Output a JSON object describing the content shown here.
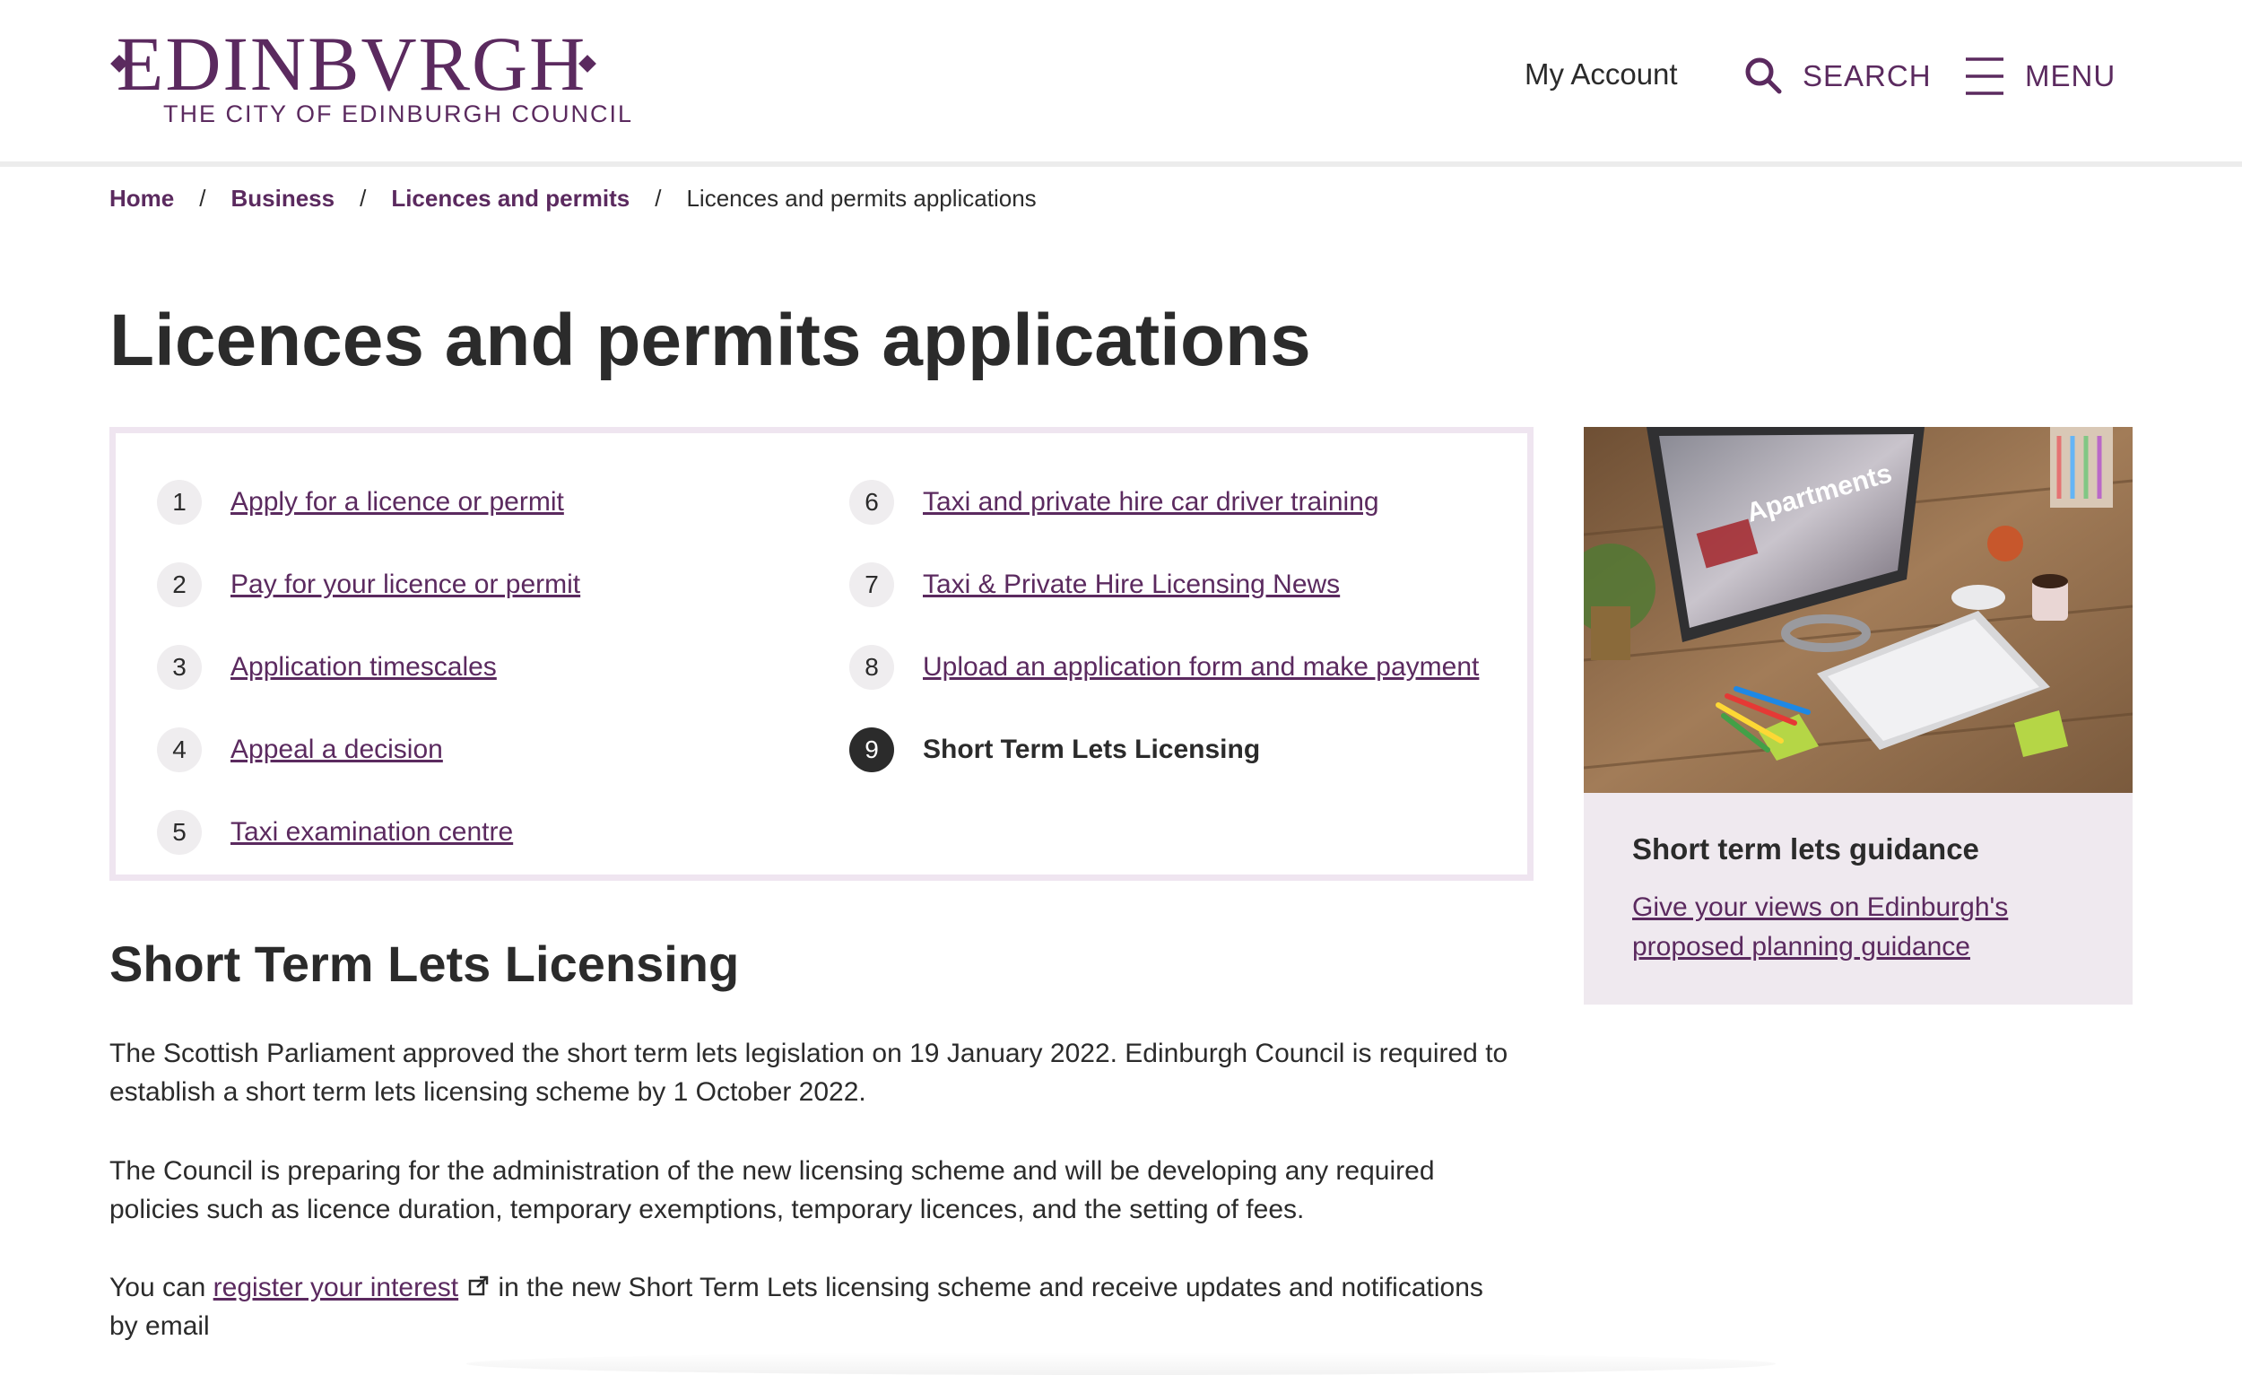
{
  "header": {
    "logo_text": "EDINBVRGH",
    "logo_subtitle": "THE CITY OF EDINBURGH COUNCIL",
    "my_account": "My Account",
    "search_label": "SEARCH",
    "menu_label": "MENU",
    "brand_color": "#5b2a5f"
  },
  "breadcrumb": {
    "items": [
      "Home",
      "Business",
      "Licences and permits"
    ],
    "current": "Licences and permits applications",
    "separator": "/"
  },
  "page": {
    "title": "Licences and permits applications"
  },
  "nav_box": {
    "items": [
      {
        "num": "1",
        "label": "Apply for a licence or permit"
      },
      {
        "num": "2",
        "label": "Pay for your licence or permit"
      },
      {
        "num": "3",
        "label": "Application timescales"
      },
      {
        "num": "4",
        "label": "Appeal a decision"
      },
      {
        "num": "5",
        "label": "Taxi examination centre"
      },
      {
        "num": "6",
        "label": "Taxi and private hire car driver training"
      },
      {
        "num": "7",
        "label": "Taxi & Private Hire Licensing News"
      },
      {
        "num": "8",
        "label": "Upload an application form and make payment"
      },
      {
        "num": "9",
        "label": "Short Term Lets Licensing",
        "current": true
      }
    ]
  },
  "section": {
    "heading": "Short Term Lets Licensing",
    "p1": "The Scottish Parliament approved the short term lets legislation on 19 January 2022.  Edinburgh Council  is required to establish a short term lets licensing scheme by 1 October 2022.",
    "p2": "The Council is preparing for the administration of the new licensing scheme and will be developing any required policies such as licence duration, temporary exemptions, temporary licences, and the setting of fees.",
    "p3_before": "You can ",
    "p3_link": "register your interest",
    "p3_after": " in the new Short Term Lets licensing scheme and receive updates and notifications by email"
  },
  "sidebar": {
    "image_text": "Apartments",
    "title": "Short term lets guidance",
    "link": "Give your views on Edinburgh's proposed planning guidance"
  }
}
